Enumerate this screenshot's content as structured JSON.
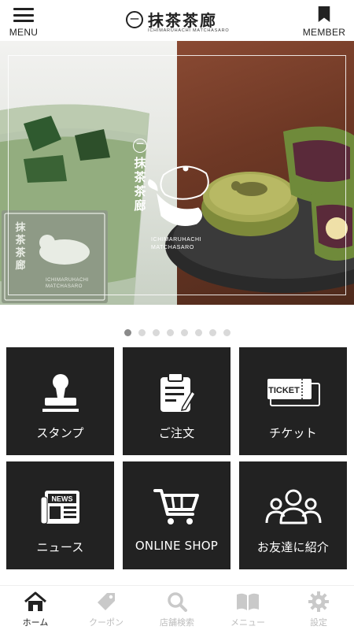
{
  "header": {
    "menu_label": "MENU",
    "member_label": "MEMBER",
    "logo_mark": "一",
    "logo_title": "抹茶茶廊",
    "logo_sub": "ICHIMARUHACHI MATCHASARO"
  },
  "hero": {
    "brand_mark": "一",
    "brand_vertical": [
      "抹",
      "茶",
      "茶",
      "廊"
    ],
    "brand_side_line1": "ICHIMARUHACHI",
    "brand_side_line2": "MATCHASARO",
    "cup_line1": "ICHIMARUHACHI",
    "cup_line2": "MATCHASARO",
    "cup_vertical": [
      "抹",
      "茶",
      "茶",
      "廊"
    ],
    "slide_count": 8,
    "active_slide": 0
  },
  "grid": {
    "tiles": [
      {
        "label": "スタンプ",
        "icon": "stamp-icon"
      },
      {
        "label": "ご注文",
        "icon": "order-clipboard-icon"
      },
      {
        "label": "チケット",
        "icon": "ticket-icon",
        "icon_text": "TICKET"
      },
      {
        "label": "ニュース",
        "icon": "newspaper-icon",
        "icon_text": "NEWS"
      },
      {
        "label": "ONLINE SHOP",
        "icon": "shopping-cart-icon"
      },
      {
        "label": "お友達に紹介",
        "icon": "friends-icon"
      }
    ]
  },
  "tabbar": {
    "tabs": [
      {
        "label": "ホーム",
        "icon": "home-icon",
        "active": true
      },
      {
        "label": "クーポン",
        "icon": "coupon-tag-icon",
        "active": false
      },
      {
        "label": "店舗検索",
        "icon": "search-icon",
        "active": false
      },
      {
        "label": "メニュー",
        "icon": "book-icon",
        "active": false
      },
      {
        "label": "設定",
        "icon": "gear-icon",
        "active": false
      }
    ]
  },
  "colors": {
    "tile_bg": "#222222",
    "tab_inactive": "#bdbdbd",
    "tab_active": "#222222",
    "dot_inactive": "#d9d9d9",
    "dot_active": "#8a8a8a"
  }
}
